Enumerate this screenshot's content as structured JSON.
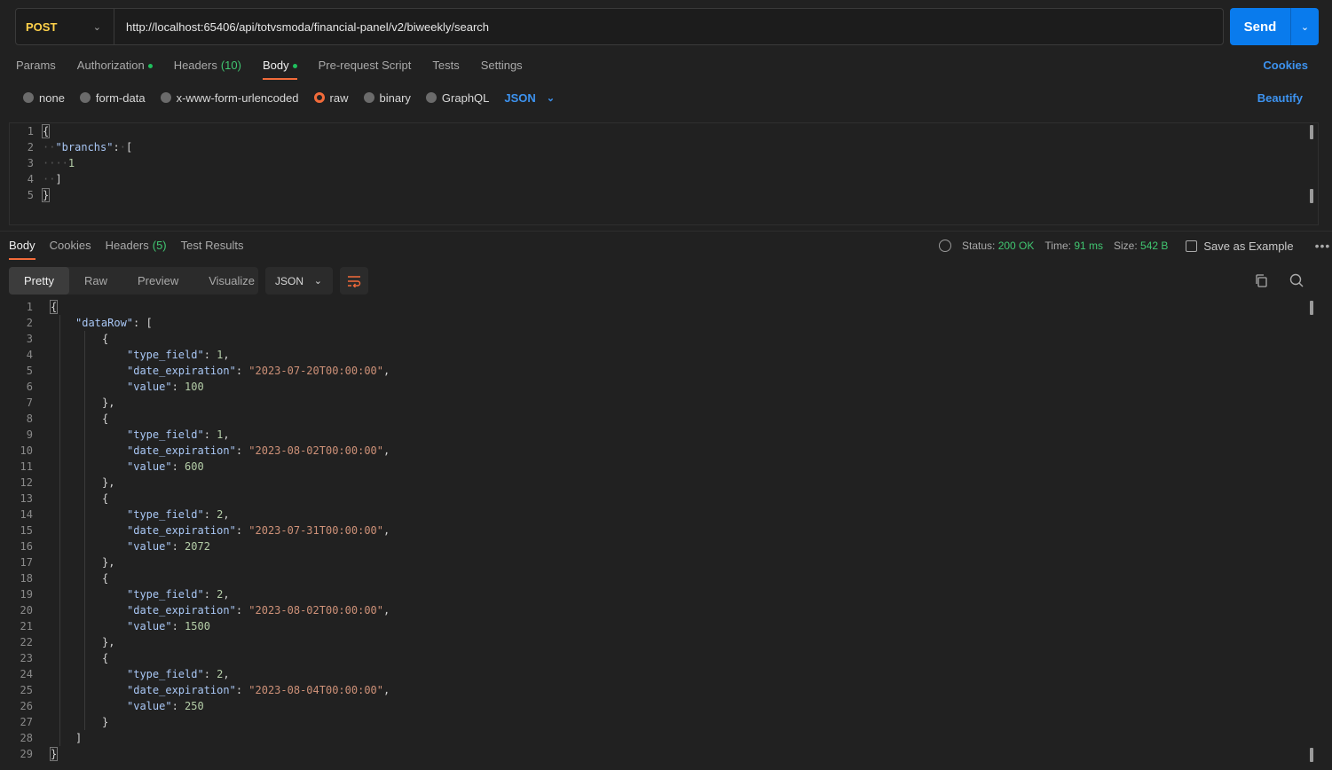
{
  "request": {
    "method": "POST",
    "url": "http://localhost:65406/api/totvsmoda/financial-panel/v2/biweekly/search",
    "send_label": "Send"
  },
  "request_tabs": [
    {
      "label": "Params"
    },
    {
      "label": "Authorization"
    },
    {
      "label": "Headers",
      "count": "(10)"
    },
    {
      "label": "Body"
    },
    {
      "label": "Pre-request Script"
    },
    {
      "label": "Tests"
    },
    {
      "label": "Settings"
    }
  ],
  "cookies_label": "Cookies",
  "body_types": [
    "none",
    "form-data",
    "x-www-form-urlencoded",
    "raw",
    "binary",
    "GraphQL"
  ],
  "body_format": "JSON",
  "beautify_label": "Beautify",
  "request_body_lines": [
    "1",
    "2",
    "3",
    "4",
    "5"
  ],
  "request_body": {
    "key": "\"branchs\"",
    "value": "1"
  },
  "response_tabs": [
    {
      "label": "Body"
    },
    {
      "label": "Cookies"
    },
    {
      "label": "Headers",
      "count": "(5)"
    },
    {
      "label": "Test Results"
    }
  ],
  "response_meta": {
    "status_label": "Status:",
    "status": "200 OK",
    "time_label": "Time:",
    "time": "91 ms",
    "size_label": "Size:",
    "size": "542 B",
    "save_label": "Save as Example"
  },
  "view_modes": [
    "Pretty",
    "Raw",
    "Preview",
    "Visualize"
  ],
  "response_format": "JSON",
  "response_json": {
    "root_key": "\"dataRow\"",
    "rows": [
      {
        "type_field": "1",
        "date_expiration": "\"2023-07-20T00:00:00\"",
        "value": "100"
      },
      {
        "type_field": "1",
        "date_expiration": "\"2023-08-02T00:00:00\"",
        "value": "600"
      },
      {
        "type_field": "2",
        "date_expiration": "\"2023-07-31T00:00:00\"",
        "value": "2072"
      },
      {
        "type_field": "2",
        "date_expiration": "\"2023-08-02T00:00:00\"",
        "value": "1500"
      },
      {
        "type_field": "2",
        "date_expiration": "\"2023-08-04T00:00:00\"",
        "value": "250"
      }
    ],
    "line_count": 29
  },
  "colors": {
    "accent_orange": "#f26b3a",
    "send_blue": "#097bed",
    "status_green": "#41c671",
    "method_yellow": "#ffd24a"
  }
}
